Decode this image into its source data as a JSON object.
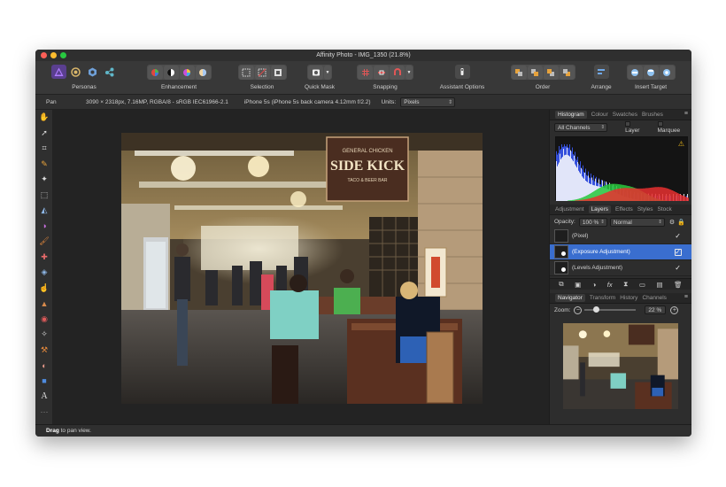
{
  "window": {
    "title": "Affinity Photo - IMG_1350 (21.8%)"
  },
  "toolbar": {
    "groups": [
      {
        "label": "Personas",
        "icons": [
          "photo-persona-icon",
          "liquify-persona-icon",
          "develop-persona-icon",
          "export-persona-icon"
        ]
      },
      {
        "label": "Enhancement",
        "icons": [
          "auto-levels-icon",
          "auto-contrast-icon",
          "auto-colors-icon",
          "auto-white-balance-icon"
        ]
      },
      {
        "label": "Selection",
        "icons": [
          "select-all-icon",
          "deselect-icon",
          "invert-selection-icon"
        ]
      },
      {
        "label": "Quick Mask",
        "icons": [
          "quick-mask-icon",
          "dropdown-icon"
        ]
      },
      {
        "label": "Snapping",
        "icons": [
          "grid-icon",
          "snapping-icon",
          "magnet-icon",
          "dropdown-icon"
        ]
      },
      {
        "label": "Assistant Options",
        "icons": [
          "assistant-icon"
        ]
      },
      {
        "label": "Order",
        "icons": [
          "move-to-back-icon",
          "move-back-one-icon",
          "move-forward-one-icon",
          "move-to-front-icon"
        ]
      },
      {
        "label": "Arrange",
        "icons": [
          "align-icon"
        ]
      },
      {
        "label": "Insert Target",
        "icons": [
          "insert-behind-icon",
          "insert-top-icon",
          "insert-inside-icon"
        ]
      }
    ]
  },
  "context": {
    "tool": "Pan",
    "info": "3090 × 2318px, 7.16MP, RGBA/8 - sRGB IEC61966-2.1",
    "camera": "iPhone 5s (iPhone 5s back camera 4.12mm f/2.2)",
    "units_label": "Units:",
    "units_value": "Pixels"
  },
  "tools": [
    "hand-icon",
    "move-icon",
    "crop-icon",
    "color-picker-icon",
    "sharpen-icon",
    "marquee-icon",
    "flood-fill-icon",
    "gradient-icon",
    "paint-brush-icon",
    "healing-icon",
    "clone-icon",
    "smudge-icon",
    "burn-icon",
    "red-eye-icon",
    "blemish-icon",
    "erase-icon",
    "dodge-icon",
    "shape-icon",
    "text-icon",
    "more-icon"
  ],
  "panels": {
    "top_tabs": [
      "Histogram",
      "Colour",
      "Swatches",
      "Brushes"
    ],
    "histogram": {
      "channel": "All Channels",
      "layer_label": "Layer",
      "marquee_label": "Marquee"
    },
    "mid_tabs": [
      "Adjustment",
      "Layers",
      "Effects",
      "Styles",
      "Stock"
    ],
    "layers_panel": {
      "opacity_label": "Opacity:",
      "opacity_value": "100 %",
      "blend_mode": "Normal",
      "layers": [
        {
          "name": "(Pixel)"
        },
        {
          "name": "(Exposure Adjustment)"
        },
        {
          "name": "(Levels Adjustment)"
        }
      ]
    },
    "bottom_tabs": [
      "Navigator",
      "Transform",
      "History",
      "Channels"
    ],
    "navigator": {
      "zoom_label": "Zoom:",
      "zoom_value": "22 %"
    }
  },
  "status": {
    "bold": "Drag",
    "text": " to pan view."
  }
}
